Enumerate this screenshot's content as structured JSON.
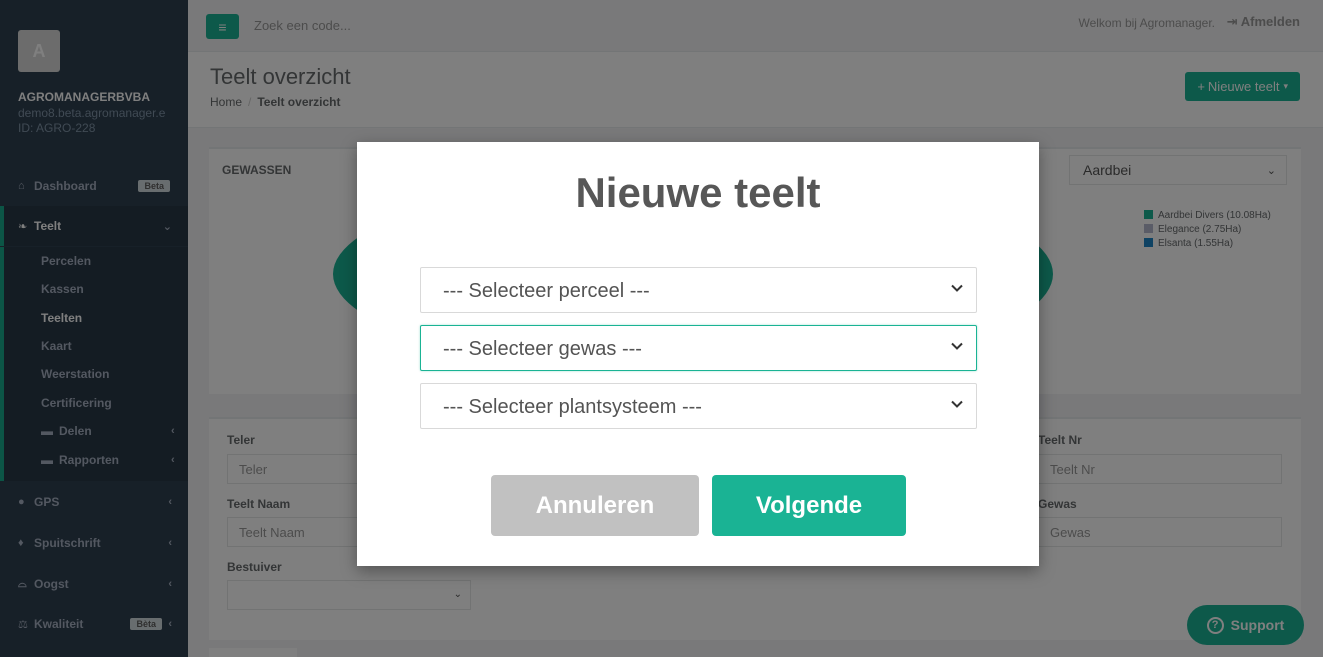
{
  "sidebar": {
    "avatar_letter": "A",
    "company": "AGROMANAGERBVBA",
    "email": "demo8.beta.agromanager.e",
    "user_id": "ID: AGRO-228",
    "dashboard": {
      "label": "Dashboard",
      "badge": "Beta"
    },
    "teelt": {
      "label": "Teelt"
    },
    "sub_items": [
      "Percelen",
      "Kassen",
      "Teelten",
      "Kaart",
      "Weerstation",
      "Certificering",
      "Delen",
      "Rapporten"
    ],
    "gps": "GPS",
    "spuitschrift": "Spuitschrift",
    "oogst": "Oogst",
    "kwaliteit": {
      "label": "Kwaliteit",
      "badge": "Bèta"
    }
  },
  "topbar": {
    "search_placeholder": "Zoek een code...",
    "welcome": "Welkom bij Agromanager.",
    "logout": "Afmelden"
  },
  "heading": {
    "title": "Teelt overzicht",
    "crumb_home": "Home",
    "crumb_current": "Teelt overzicht",
    "new_button": "Nieuwe teelt"
  },
  "gewassen": {
    "title": "GEWASSEN",
    "selected": "Aardbei",
    "legend": [
      {
        "label": "Aardbei Divers (10.08Ha)",
        "color": "#1ab394"
      },
      {
        "label": "Elegance (2.75Ha)",
        "color": "#b5b8cf"
      },
      {
        "label": "Elsanta (1.55Ha)",
        "color": "#1c84c6"
      }
    ]
  },
  "form": {
    "teler_label": "Teler",
    "teler_placeholder": "Teler",
    "teelt_naam_label": "Teelt Naam",
    "teelt_naam_placeholder": "Teelt Naam",
    "bestuiver_label": "Bestuiver",
    "teelt_nr_label": "Teelt Nr",
    "teelt_nr_placeholder": "Teelt Nr",
    "gewas_label": "Gewas",
    "gewas_placeholder": "Gewas"
  },
  "support": "Support",
  "modal": {
    "title": "Nieuwe teelt",
    "perceel": "--- Selecteer perceel ---",
    "gewas": "--- Selecteer gewas ---",
    "plantsysteem": "--- Selecteer plantsysteem ---",
    "cancel": "Annuleren",
    "next": "Volgende"
  },
  "colors": {
    "accent": "#1ab394",
    "sidebar": "#2f4050"
  }
}
